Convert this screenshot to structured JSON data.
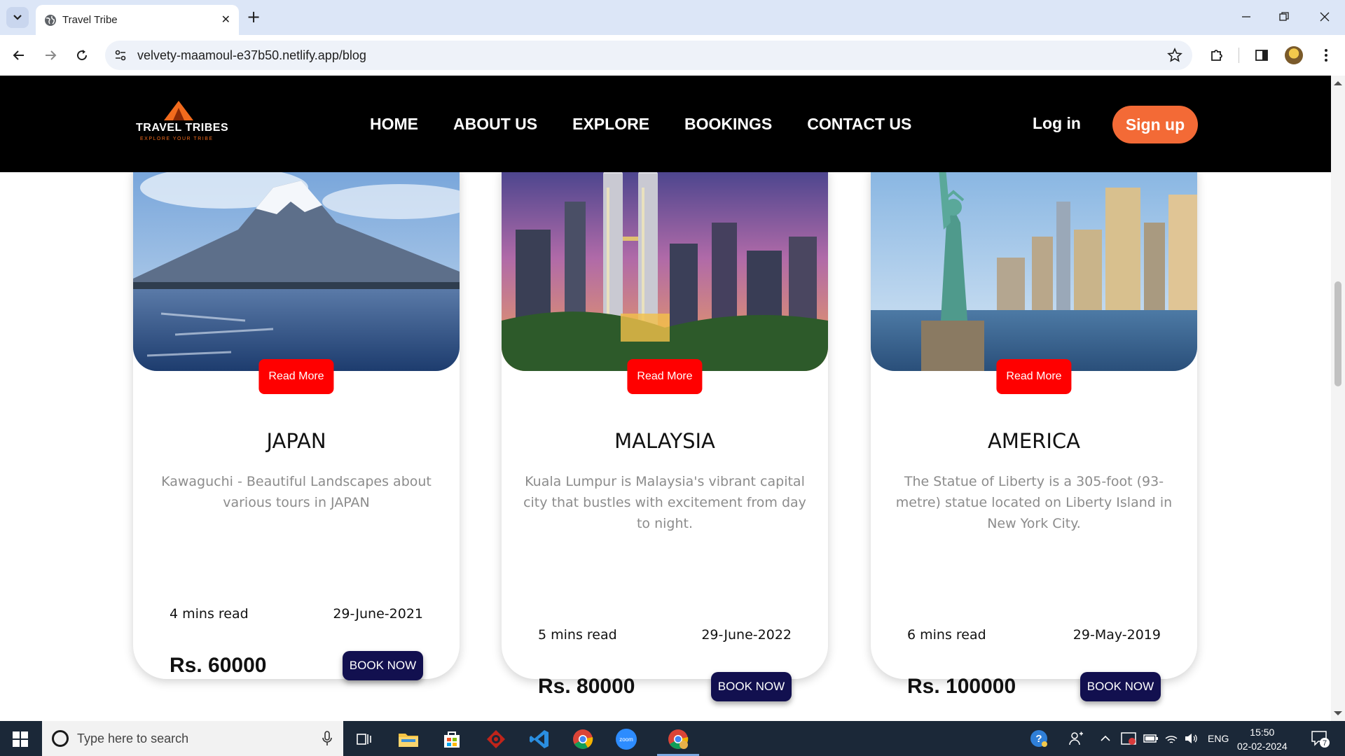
{
  "browser": {
    "tab_title": "Travel Tribe",
    "tab_close": "✕",
    "new_tab": "+",
    "url": "velvety-maamoul-e37b50.netlify.app/blog"
  },
  "site": {
    "logo_name": "TRAVEL TRIBES",
    "logo_tagline": "EXPLORE YOUR TRIBE",
    "nav": [
      "HOME",
      "ABOUT US",
      "EXPLORE",
      "BOOKINGS",
      "CONTACT US"
    ],
    "login": "Log in",
    "signup": "Sign up",
    "colors": {
      "header": "#000000",
      "signup": "#f36a36",
      "read_more": "#ff0000",
      "book": "#12104f"
    }
  },
  "cards": [
    {
      "read_more": "Read More",
      "title": "JAPAN",
      "description": "Kawaguchi - Beautiful Landscapes about various tours in JAPAN",
      "read_time": "4 mins read",
      "date": "29-June-2021",
      "price": "Rs. 60000",
      "book": "BOOK NOW"
    },
    {
      "read_more": "Read More",
      "title": "MALAYSIA",
      "description": "Kuala Lumpur is Malaysia's vibrant capital city that bustles with excitement from day to night.",
      "read_time": "5 mins read",
      "date": "29-June-2022",
      "price": "Rs. 80000",
      "book": "BOOK NOW"
    },
    {
      "read_more": "Read More",
      "title": "AMERICA",
      "description": "The Statue of Liberty is a 305-foot (93-metre) statue located on Liberty Island in New York City.",
      "read_time": "6 mins read",
      "date": "29-May-2019",
      "price": "Rs. 100000",
      "book": "BOOK NOW"
    }
  ],
  "taskbar": {
    "search_placeholder": "Type here to search",
    "language": "ENG",
    "time": "15:50",
    "date": "02-02-2024",
    "notifications": "7",
    "zoom_label": "zoom"
  }
}
